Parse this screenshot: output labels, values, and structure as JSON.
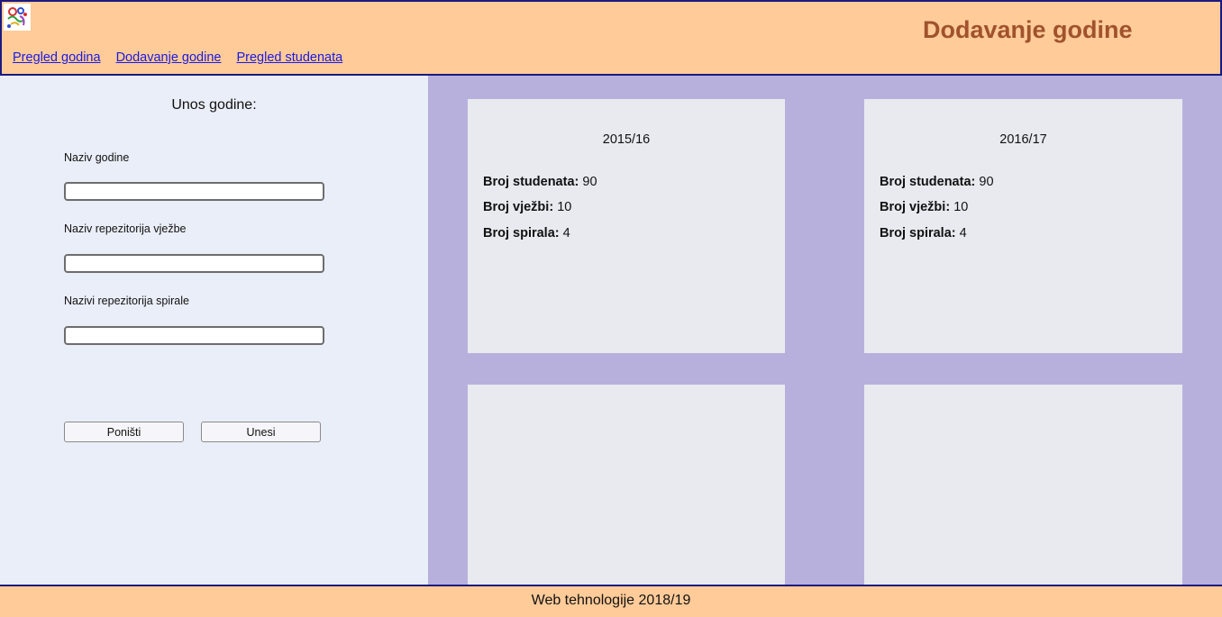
{
  "header": {
    "title": "Dodavanje godine",
    "nav": [
      "Pregled godina",
      "Dodavanje godine",
      "Pregled studenata"
    ]
  },
  "form": {
    "title": "Unos godine:",
    "fields": [
      {
        "label": "Naziv godine",
        "value": ""
      },
      {
        "label": "Naziv repezitorija vježbe",
        "value": ""
      },
      {
        "label": "Nazivi repezitorija spirale",
        "value": ""
      }
    ],
    "buttons": {
      "reset": "Poništi",
      "submit": "Unesi"
    }
  },
  "cards": [
    {
      "title": "2015/16",
      "stats": [
        {
          "label": "Broj studenata:",
          "value": "90"
        },
        {
          "label": "Broj vježbi:",
          "value": "10"
        },
        {
          "label": "Broj spirala:",
          "value": "4"
        }
      ]
    },
    {
      "title": "2016/17",
      "stats": [
        {
          "label": "Broj studenata:",
          "value": "90"
        },
        {
          "label": "Broj vježbi:",
          "value": "10"
        },
        {
          "label": "Broj spirala:",
          "value": "4"
        }
      ]
    }
  ],
  "footer": {
    "text": "Web tehnologije 2018/19"
  },
  "colors": {
    "header_bg": "#ffcb99",
    "border": "#1a1a80",
    "title": "#a0522d",
    "link": "#1a1ae0",
    "form_bg": "#eaeef8",
    "grid_bg": "#b8b0dc",
    "card_bg": "#e8eaf0"
  },
  "icons": {
    "logo": "logo-icon"
  }
}
